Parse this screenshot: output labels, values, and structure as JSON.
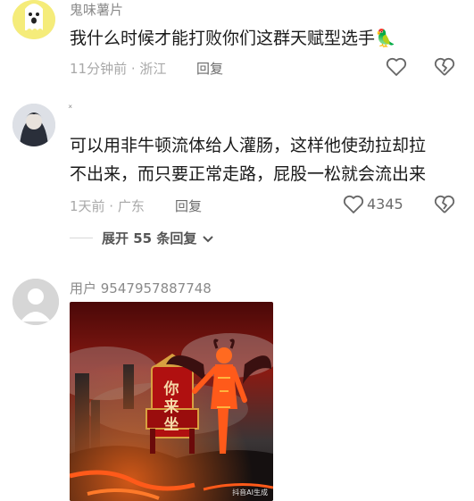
{
  "comments": [
    {
      "username": "鬼味薯片",
      "text": "我什么时候才能打败你们这群天赋型选手🦜",
      "meta": "11分钟前 · 浙江",
      "reply_label": "回复",
      "like_count": ""
    },
    {
      "username": "ˣ",
      "text_line1": "可以用非牛顿流体给人灌肠，这样他使劲拉却拉",
      "text_line2": "不出来，而只要正常走路，屁股一松就会流出来",
      "meta": "1天前 · 广东",
      "reply_label": "回复",
      "like_count": "4345",
      "expand_label": "展开 55 条回复"
    },
    {
      "username": "用户 9547957887748",
      "image_caption": "你来坐",
      "image_watermark": "抖音AI生成"
    }
  ],
  "colors": {
    "lava": "#ff5a1a",
    "throne_red": "#b01010",
    "sky_red": "#7a0f0f"
  }
}
